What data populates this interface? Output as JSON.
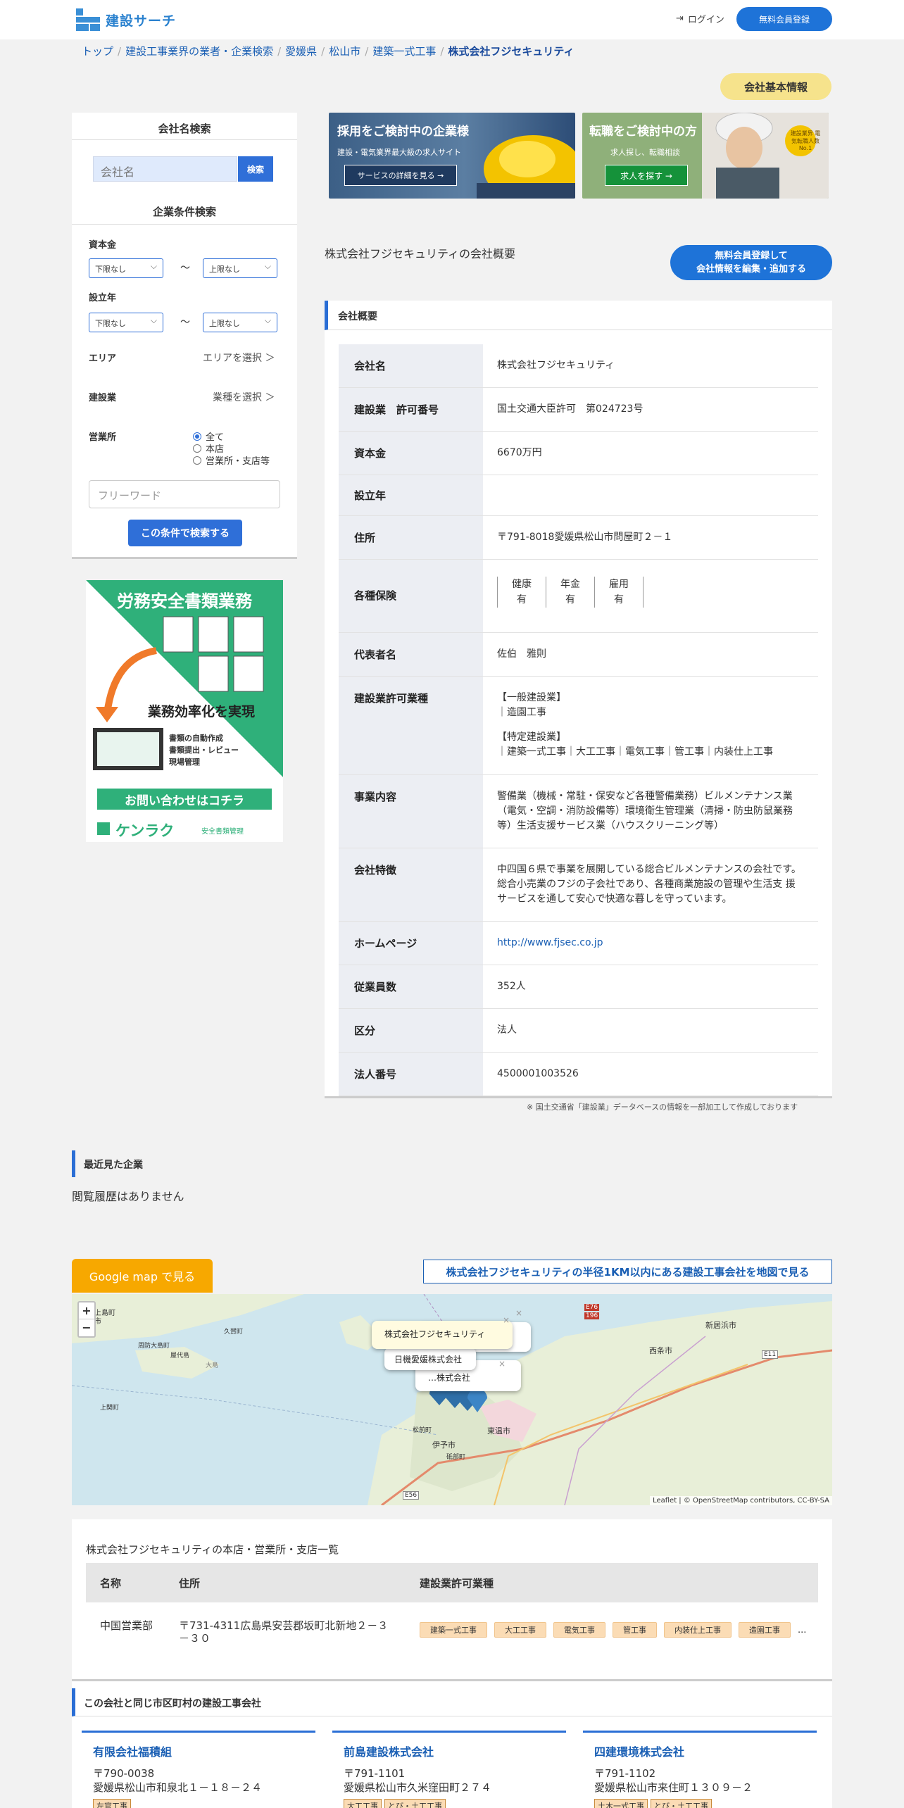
{
  "header": {
    "logo_text": "建設サーチ",
    "login_label": "ログイン",
    "register_label": "無料会員登録"
  },
  "breadcrumb": [
    "トップ",
    "建設工事業界の業者・企業検索",
    "愛媛県",
    "松山市",
    "建築一式工事",
    "株式会社フジセキュリティ"
  ],
  "basic_info_tag": "会社基本情報",
  "sidebar": {
    "name_search_title": "会社名検索",
    "name_placeholder": "会社名",
    "name_search_button": "検索",
    "condition_title": "企業条件検索",
    "capital_label": "資本金",
    "established_label": "設立年",
    "min_option": "下限なし",
    "max_option": "上限なし",
    "tilde": "〜",
    "area_label": "エリア",
    "area_value": "エリアを選択 ＞",
    "industry_label": "建設業",
    "industry_value": "業種を選択 ＞",
    "office_label": "営業所",
    "office_options": [
      "全て",
      "本店",
      "営業所・支店等"
    ],
    "free_word_placeholder": "フリーワード",
    "search_button": "この条件で検索する"
  },
  "ad": {
    "headline": "労務安全書類業務",
    "sub": "業務効率化を実現",
    "bullets": [
      "書類の自動作成",
      "書類提出・レビュー",
      "現場管理"
    ],
    "cta": "お問い合わせはコチラ",
    "brand": "ケンラク",
    "brand_sub": "安全書類管理"
  },
  "banners": [
    {
      "title": "採用をご検討中の企業様",
      "sub": "建設・電気業界最大級の求人サイト",
      "button": "サービスの詳細を見る →"
    },
    {
      "title": "転職をご検討中の方",
      "sub": "求人探し、転職相談",
      "button": "求人を探す →",
      "badge": "建設業界 電気転職人数 No.1"
    }
  ],
  "overview": {
    "page_title": "株式会社フジセキュリティの会社概要",
    "edit_button_line1": "無料会員登録して",
    "edit_button_line2": "会社情報を編集・追加する",
    "section_title": "会社概要",
    "rows": {
      "company_name": {
        "k": "会社名",
        "v": "株式会社フジセキュリティ"
      },
      "license_no": {
        "k": "建設業　許可番号",
        "v": "国土交通大臣許可　第024723号"
      },
      "capital": {
        "k": "資本金",
        "v": "6670万円"
      },
      "established": {
        "k": "設立年",
        "v": ""
      },
      "address": {
        "k": "住所",
        "v": "〒791-8018愛媛県松山市問屋町２－１"
      },
      "insurance": {
        "k": "各種保険",
        "items": [
          {
            "name": "健康",
            "val": "有"
          },
          {
            "name": "年金",
            "val": "有"
          },
          {
            "name": "雇用",
            "val": "有"
          }
        ]
      },
      "representative": {
        "k": "代表者名",
        "v": "佐伯　雅則"
      },
      "license_types": {
        "k": "建設業許可業種",
        "general_head": "【一般建設業】",
        "general": "｜造園工事",
        "special_head": "【特定建設業】",
        "special": "｜建築一式工事｜大工工事｜電気工事｜管工事｜内装仕上工事"
      },
      "business": {
        "k": "事業内容",
        "v": "警備業（機械・常駐・保安など各種警備業務）ビルメンテナンス業（電気・空調・消防設備等）環境衛生管理業（清掃・防虫防鼠業務 等）生活支援サービス業（ハウスクリーニング等）"
      },
      "features": {
        "k": "会社特徴",
        "v": "中四国６県で事業を展開している総合ビルメンテナンスの会社です。総合小売業のフジの子会社であり、各種商業施設の管理や生活支 援サービスを通して安心で快適な暮しを守っています。"
      },
      "homepage": {
        "k": "ホームページ",
        "v": "http://www.fjsec.co.jp"
      },
      "employees": {
        "k": "従業員数",
        "v": "352人"
      },
      "category": {
        "k": "区分",
        "v": "法人"
      },
      "corp_no": {
        "k": "法人番号",
        "v": "4500001003526"
      }
    },
    "note": "※ 国土交通省「建設業」データベースの情報を一部加工して作成しております"
  },
  "recent": {
    "title": "最近見た企業",
    "empty": "閲覧履歴はありません"
  },
  "map": {
    "google_button": "Google map で見る",
    "radius_link": "株式会社フジセキュリティの半径1KM以内にある建設工事会社を地図で見る",
    "popups": [
      "株式会社フジセキュリティ",
      "日機愛媛株式会社",
      "…株式会社"
    ],
    "labels": [
      "新居浜市",
      "西条市",
      "東温市",
      "伊予市",
      "松前町",
      "砥部町",
      "上島町",
      "周防大島町",
      "屋代島",
      "大島",
      "上関町",
      "柳井市",
      "久賀町",
      "E56",
      "E11",
      "E76",
      "196"
    ],
    "attribution": "Leaflet | © OpenStreetMap contributors, CC-BY-SA",
    "zoom_in": "+",
    "zoom_out": "−"
  },
  "branches": {
    "title": "株式会社フジセキュリティの本店・営業所・支店一覧",
    "headers": [
      "名称",
      "住所",
      "建設業許可業種"
    ],
    "rows": [
      {
        "name": "中国営業部",
        "address": "〒731-4311広島県安芸郡坂町北新地２－３－３０",
        "tags": [
          "建築一式工事",
          "大工工事",
          "電気工事",
          "管工事",
          "内装仕上工事",
          "造園工事"
        ],
        "more": "..."
      }
    ]
  },
  "same_area": {
    "title": "この会社と同じ市区町村の建設工事会社",
    "cards": [
      {
        "name": "有限会社福積組",
        "zip": "〒790-0038",
        "addr": "愛媛県松山市和泉北１－１８－２４",
        "tags": [
          "左官工事"
        ]
      },
      {
        "name": "前島建設株式会社",
        "zip": "〒791-1101",
        "addr": "愛媛県松山市久米窪田町２７４",
        "tags": [
          "大工工事",
          "とび・土工工事"
        ]
      },
      {
        "name": "四建環境株式会社",
        "zip": "〒791-1102",
        "addr": "愛媛県松山市来住町１３０９－２",
        "tags": [
          "土木一式工事",
          "とび・土工工事"
        ]
      }
    ]
  },
  "colors": {
    "accent": "#1e73d8",
    "tag_yellow": "#f6e38c",
    "map_button": "#f7a800"
  }
}
